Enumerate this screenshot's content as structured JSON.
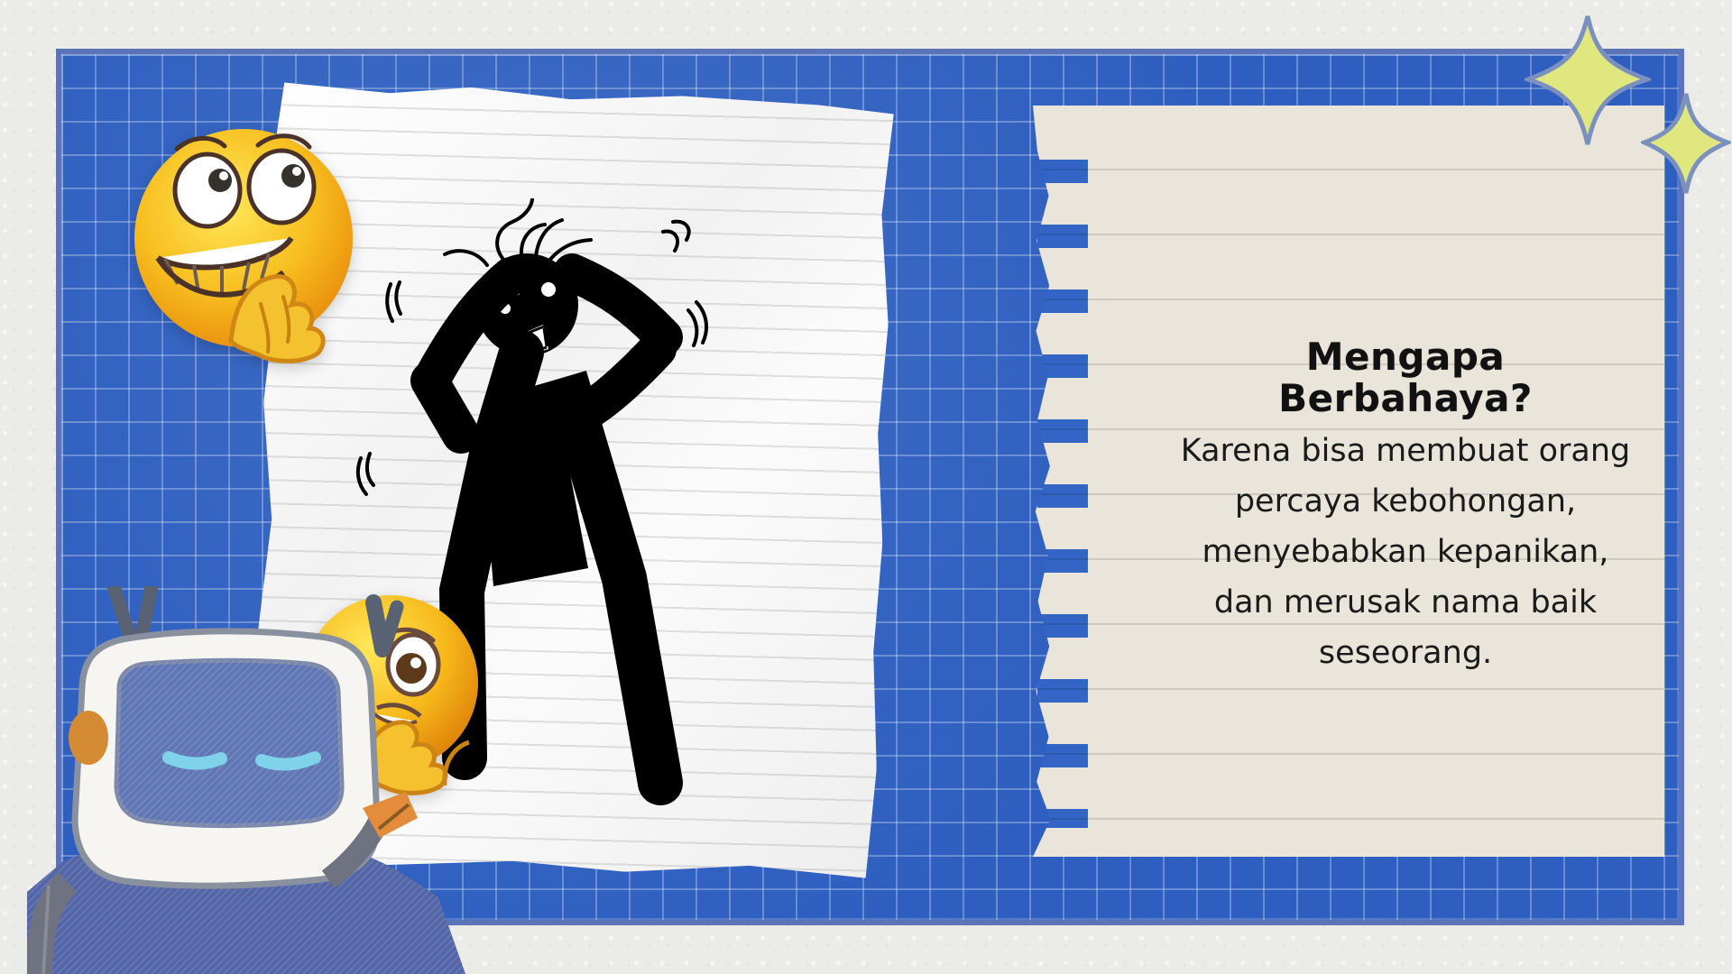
{
  "slide": {
    "background_color": "#ebebe8",
    "board_color": "#2e5fc0",
    "notebook_color": "#eae5da"
  },
  "text_block": {
    "title": "Mengapa Berbahaya?",
    "description_lines": [
      "Karena bisa membuat orang",
      "percaya kebohongan,",
      "menyebabkan kepanikan,",
      "dan merusak nama baik",
      "seseorang."
    ]
  },
  "illustrations": {
    "left_top_emoji": "grimacing-emoji",
    "left_bottom_emoji": "worried-emoji",
    "main_figure": "panicking-stick-figure",
    "robot": "robot-illustration",
    "sparkles": "sparkle-icon"
  },
  "colors": {
    "accent_blue": "#3564c7",
    "sparkle_yellow": "#dfe77e",
    "emoji_yellow": "#f5b719",
    "robot_blue": "#596ea7"
  }
}
